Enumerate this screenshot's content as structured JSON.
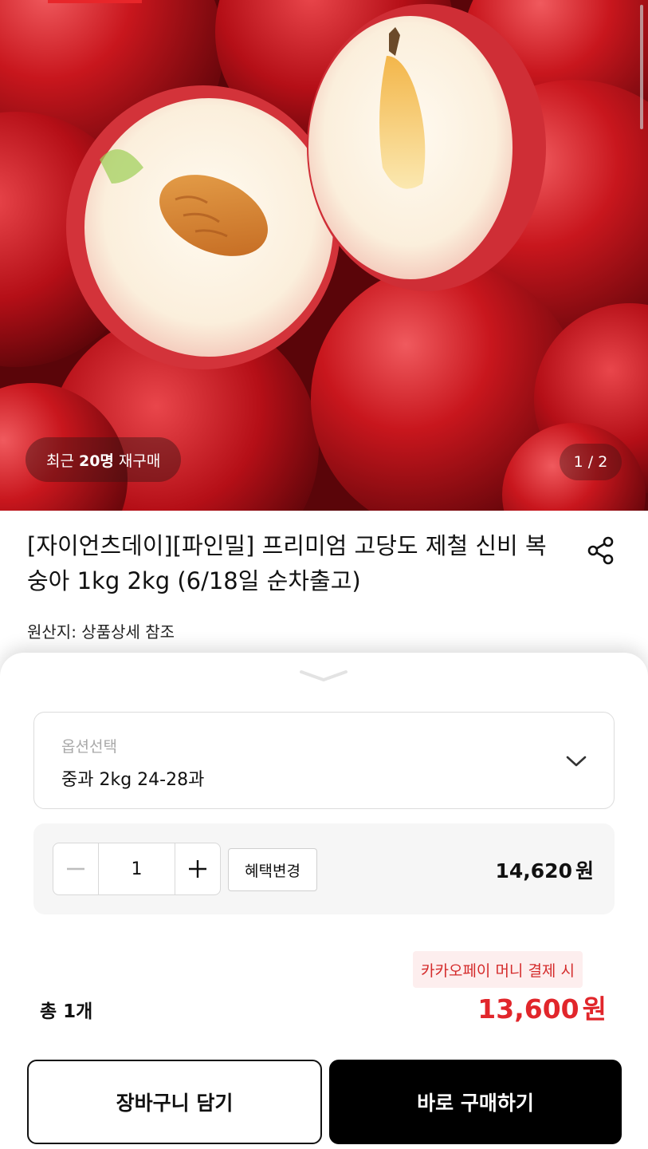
{
  "hero": {
    "image_subject": "halved nectarines on red nectarines",
    "recent_prefix": "최근",
    "recent_count": "20명",
    "recent_suffix": "재구매",
    "page_indicator": "1 / 2"
  },
  "product": {
    "title": "[자이언츠데이][파인밀] 프리미엄 고당도 제철 신비 복숭아 1kg 2kg (6/18일 순차출고)",
    "origin": "원산지: 상품상세 참조",
    "share_icon": "share-icon"
  },
  "sheet": {
    "option": {
      "label": "옵션선택",
      "value": "중과 2kg 24-28과",
      "icon": "chevron-down-icon"
    },
    "quantity": {
      "value": "1",
      "minus_icon": "minus-icon",
      "plus_icon": "plus-icon",
      "benefit_button": "혜택변경",
      "price": "14,620",
      "currency": "원"
    },
    "payment_note": "카카오페이 머니 결제 시",
    "total_count": "총 1개",
    "final_price": "13,600",
    "currency": "원",
    "cart_button": "장바구니 담기",
    "buy_button": "바로 구매하기"
  },
  "colors": {
    "accent_red": "#e1262b",
    "note_bg": "#fdeeee",
    "buy_button_bg": "#000000"
  }
}
